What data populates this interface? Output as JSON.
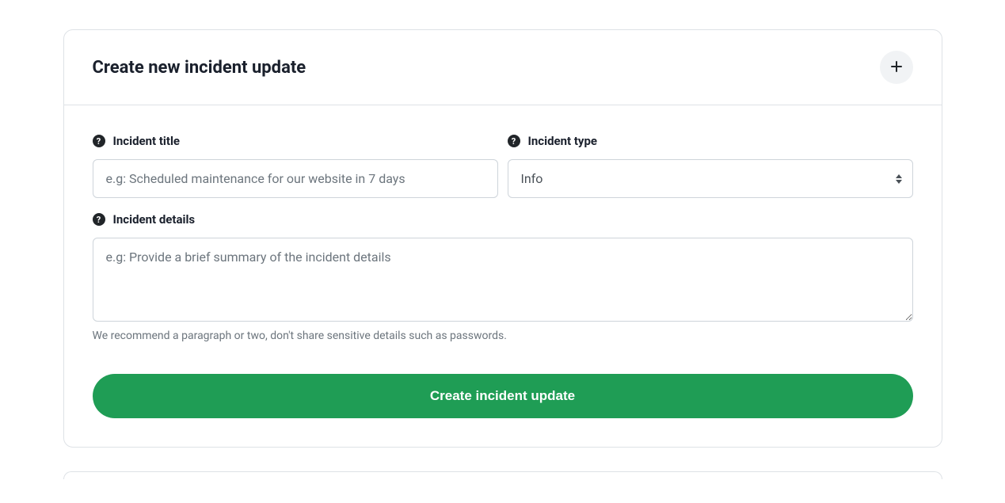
{
  "header": {
    "title": "Create new incident update"
  },
  "form": {
    "title": {
      "label": "Incident title",
      "placeholder": "e.g: Scheduled maintenance for our website in 7 days",
      "value": ""
    },
    "type": {
      "label": "Incident type",
      "selected": "Info"
    },
    "details": {
      "label": "Incident details",
      "placeholder": "e.g: Provide a brief summary of the incident details",
      "value": "",
      "hint": "We recommend a paragraph or two, don't share sensitive details such as passwords."
    },
    "submit_label": "Create incident update"
  }
}
